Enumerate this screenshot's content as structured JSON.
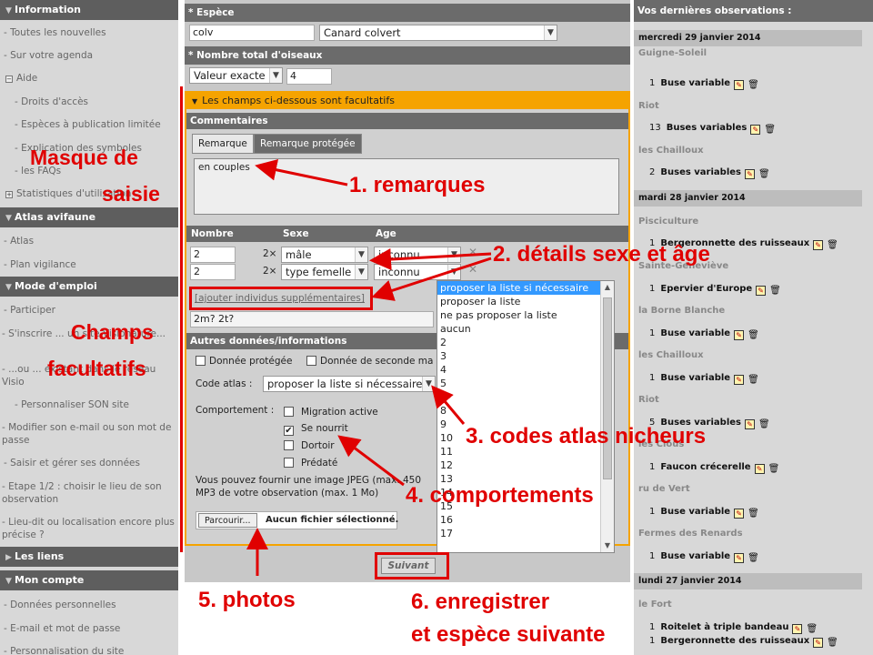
{
  "sidebar": {
    "sections": [
      {
        "label": "Information",
        "items": [
          "- Toutes les nouvelles",
          "- Sur votre agenda"
        ]
      },
      {
        "label": "Atlas avifaune",
        "items": [
          "- Atlas",
          "- Plan vigilance"
        ]
      },
      {
        "label": "Mode d'emploi",
        "items": [
          "- Participer"
        ]
      },
      {
        "label": "Les liens"
      },
      {
        "label": "Mon compte",
        "items": [
          "- Données personnelles",
          "- E-mail et mot de passe",
          "- Personnalisation du site"
        ]
      }
    ],
    "aide": "Aide",
    "aide_items": [
      "- Droits d'accès",
      "- Espèces à publication limitée",
      "- Explication des symboles",
      "- les FAQs"
    ],
    "stats": "Statistiques d'utilisation",
    "mode_items": [
      "- S'inscrire ... un site Visionature...",
      "- ...ou ... existant dans le réseau Visio",
      "- Personnaliser SON site",
      "- Modifier son e-mail ou son mot de passe",
      "- Saisir et gérer ses données",
      "- Etape 1/2 : choisir le lieu de son observation",
      "- Lieu-dit ou localisation encore plus précise ?"
    ]
  },
  "form": {
    "espece_label": "* Espèce",
    "espece_code": "colv",
    "espece_name": "Canard colvert",
    "nombre_label": "* Nombre total d'oiseaux",
    "nombre_type": "Valeur exacte",
    "nombre_value": "4",
    "optional_header": "Les champs ci-dessous sont facultatifs",
    "comments_label": "Commentaires",
    "tab_remarque": "Remarque",
    "tab_protegee": "Remarque protégée",
    "remarque_text": "en couples",
    "col_nombre": "Nombre",
    "col_sexe": "Sexe",
    "col_age": "Age",
    "rows": [
      {
        "nombre": "2",
        "mult": "2×",
        "sexe": "mâle",
        "age": "inconnu"
      },
      {
        "nombre": "2",
        "mult": "2×",
        "sexe": "type femelle",
        "age": "inconnu"
      }
    ],
    "add_link": "[ajouter individus supplémentaires]",
    "detail_note": "2m? 2t?",
    "other_label": "Autres données/informations",
    "donnee_protegee": "Donnée protégée",
    "seconde_main": "Donnée de seconde ma",
    "code_atlas_label": "Code atlas :",
    "code_atlas_value": "proposer la liste si nécessaire",
    "comportement_label": "Comportement :",
    "behaviours": [
      {
        "label": "Migration active",
        "checked": false
      },
      {
        "label": "Se nourrit",
        "checked": true
      },
      {
        "label": "Dortoir",
        "checked": false
      },
      {
        "label": "Prédaté",
        "checked": false
      }
    ],
    "upload_text": "Vous pouvez fournir une image JPEG (max. 450",
    "upload_text2": "MP3 de votre observation (max. 1 Mo)",
    "browse": "Parcourir...",
    "no_file": "Aucun fichier sélectionné.",
    "submit": "Suivant"
  },
  "dropdown": {
    "options": [
      "proposer la liste si nécessaire",
      "proposer la liste",
      "ne pas proposer la liste",
      "aucun",
      "2",
      "3",
      "4",
      "5",
      "7",
      "8",
      "9",
      "10",
      "11",
      "12",
      "13",
      "14",
      "15",
      "16",
      "17"
    ],
    "selected_index": 0
  },
  "right": {
    "title": "Vos dernières observations :",
    "dates": [
      "mercredi 29 janvier 2014",
      "mardi 28 janvier 2014",
      "lundi 27 janvier 2014"
    ],
    "places": [
      "Guigne-Soleil",
      "Riot",
      "les Chailloux",
      "Pisciculture",
      "Sainte-Geneviève",
      "la Borne Blanche",
      "les Chailloux",
      "Riot",
      "les Clous",
      "ru de Vert",
      "Fermes des Renards",
      "le Fort"
    ],
    "obs": [
      {
        "count": "1",
        "species": "Buse variable"
      },
      {
        "count": "13",
        "species": "Buses variables"
      },
      {
        "count": "2",
        "species": "Buses variables"
      },
      {
        "count": "1",
        "species": "Bergeronnette des ruisseaux"
      },
      {
        "count": "1",
        "species": "Epervier d'Europe"
      },
      {
        "count": "1",
        "species": "Buse variable"
      },
      {
        "count": "1",
        "species": "Buse variable"
      },
      {
        "count": "5",
        "species": "Buses variables"
      },
      {
        "count": "1",
        "species": "Faucon crécerelle"
      },
      {
        "count": "1",
        "species": "Buse variable"
      },
      {
        "count": "1",
        "species": "Buse variable"
      },
      {
        "count": "1",
        "species": "Roitelet à triple bandeau"
      },
      {
        "count": "1",
        "species": "Bergeronnette des ruisseaux"
      }
    ]
  },
  "annotations": {
    "masque1": "Masque de",
    "masque2": "saisie",
    "champs1": "Champs",
    "champs2": "facultatifs",
    "a1": "1. remarques",
    "a2": "2. détails sexe et âge",
    "a3": "3. codes atlas nicheurs",
    "a4": "4. comportements",
    "a5": "5. photos",
    "a6a": "6. enregistrer",
    "a6b": "et espèce suivante"
  },
  "colors": {
    "accent": "#f5a300",
    "annotation": "#e00000"
  }
}
